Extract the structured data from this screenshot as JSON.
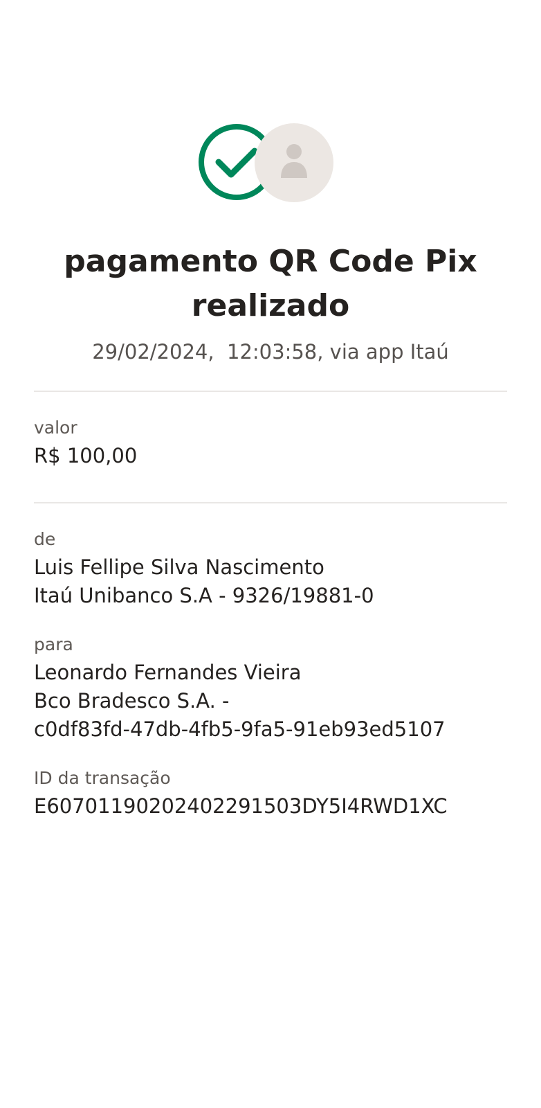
{
  "header": {
    "status_icon": "check-circle-icon",
    "avatar_icon": "person-icon",
    "title": "pagamento QR Code Pix realizado",
    "subtitle": "29/02/2024,  12:03:58, via app Itaú"
  },
  "colors": {
    "success": "#00875a",
    "avatar_bg": "#ece7e3",
    "avatar_fg": "#cfc8c3",
    "text": "#252220",
    "muted": "#5e5955",
    "divider": "#e9e7e5"
  },
  "amount": {
    "label": "valor",
    "value": "R$ 100,00"
  },
  "from": {
    "label": "de",
    "name": "Luis Fellipe Silva Nascimento",
    "account": "Itaú Unibanco S.A - 9326/19881-0"
  },
  "to": {
    "label": "para",
    "name": "Leonardo Fernandes Vieira",
    "bank": "Bco Bradesco S.A. -",
    "key": "c0df83fd-47db-4fb5-9fa5-91eb93ed5107"
  },
  "transaction": {
    "label": "ID da transação",
    "id": "E60701190202402291503DY5I4RWD1XC"
  }
}
